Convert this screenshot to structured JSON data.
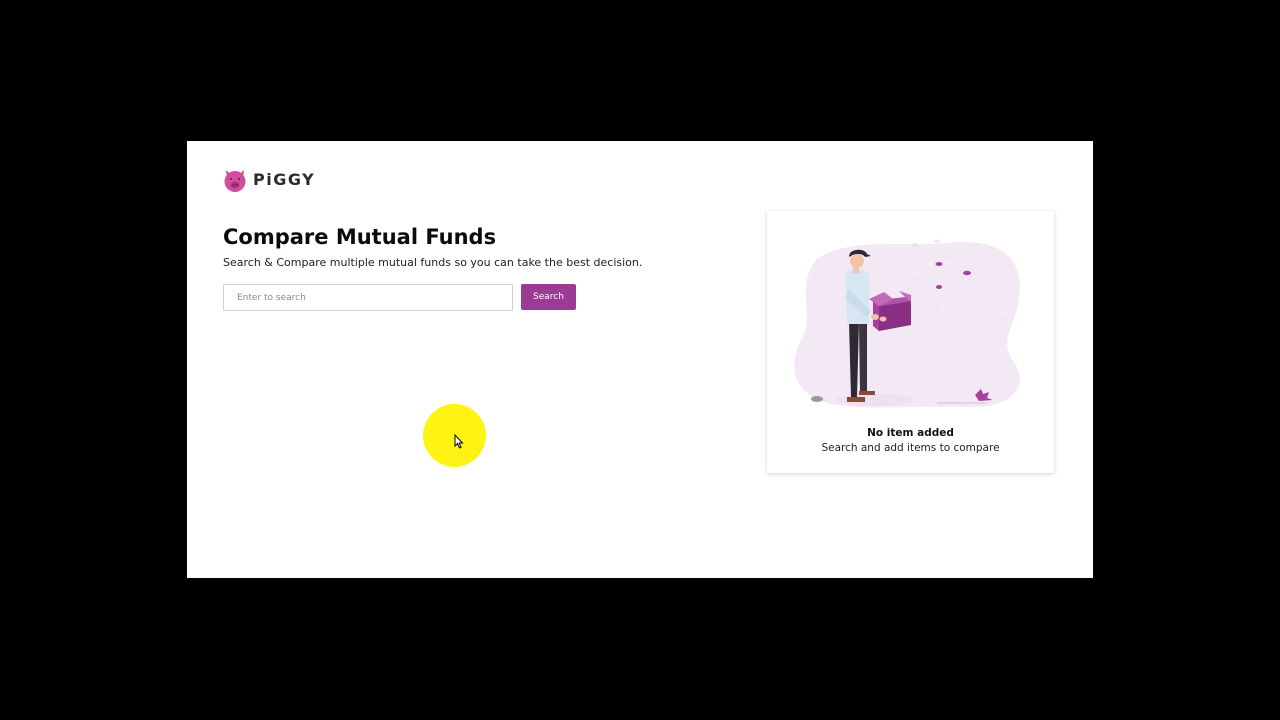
{
  "app": {
    "logo_text": "PiGGY"
  },
  "main": {
    "title": "Compare Mutual Funds",
    "subtitle": "Search & Compare multiple mutual funds so you can take the best decision.",
    "search": {
      "placeholder": "Enter to search",
      "value": "",
      "button_label": "Search"
    }
  },
  "compare_panel": {
    "empty_title": "No item added",
    "empty_subtitle": "Search and add items to compare",
    "illustration": "empty-box-person-illustration"
  },
  "colors": {
    "accent": "#9b3c94",
    "logo_pink": "#d14d9f",
    "blob": "#f3e9f4"
  },
  "overlay": {
    "cursor_highlight_color": "#fff200",
    "cursor_icon": "mouse-pointer-icon"
  }
}
